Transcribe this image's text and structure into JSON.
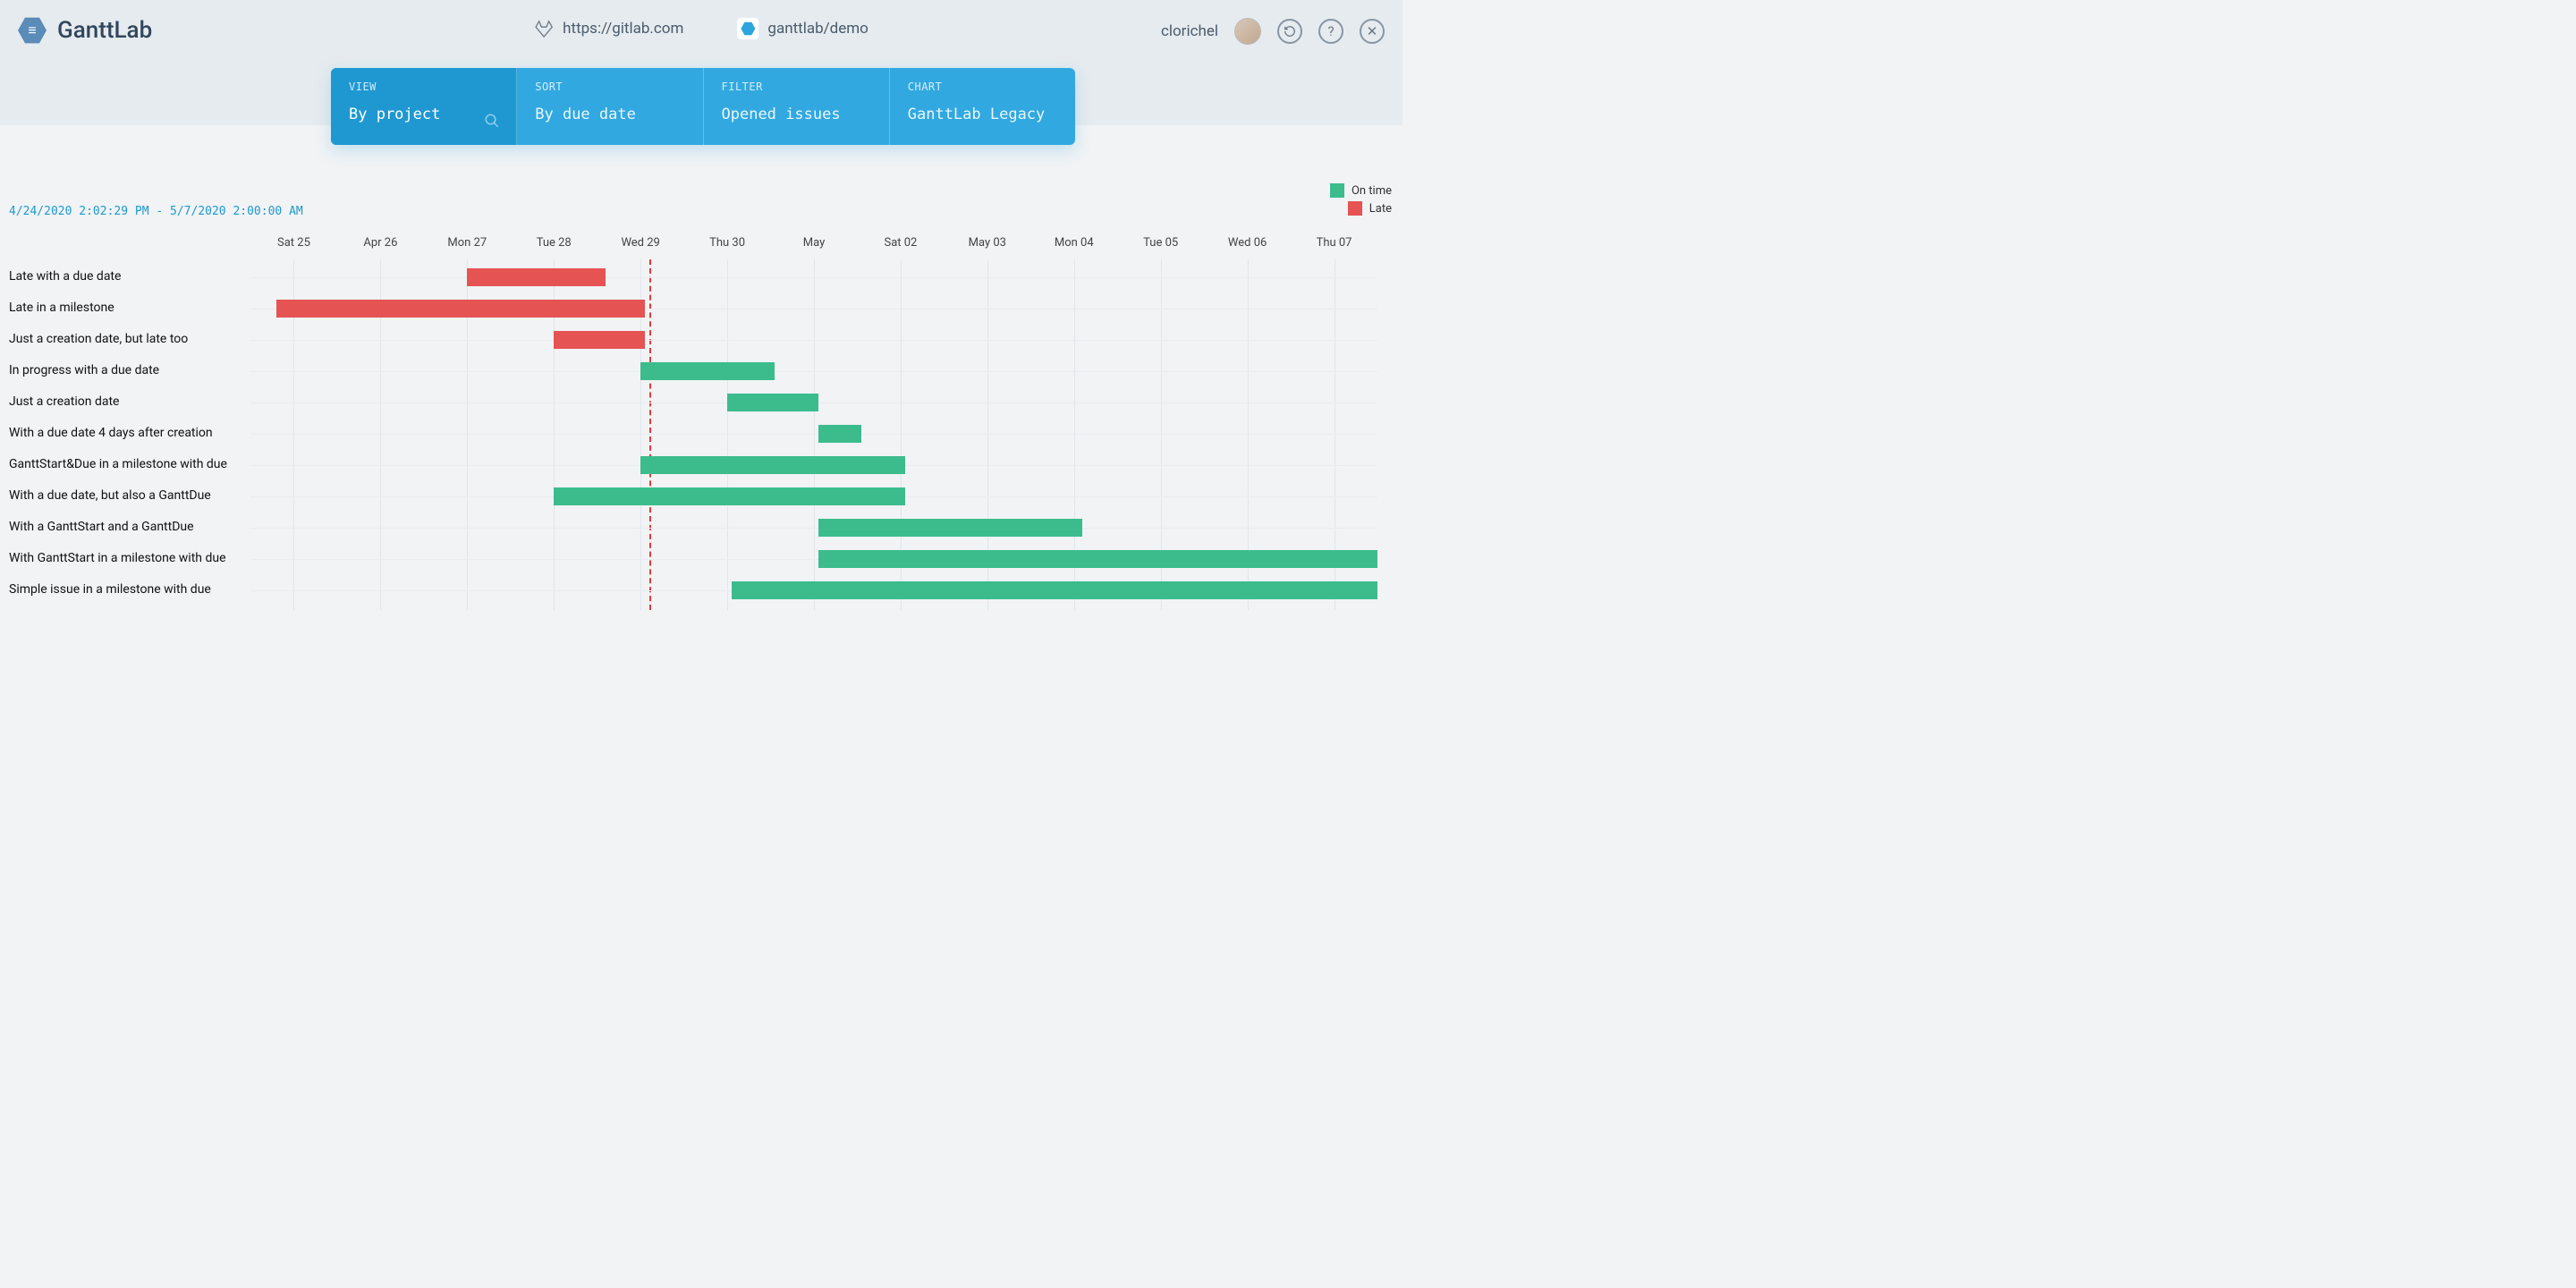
{
  "brand": {
    "title": "GanttLab"
  },
  "header": {
    "source_url": "https://gitlab.com",
    "project_path": "ganttlab/demo",
    "username": "clorichel"
  },
  "controls": {
    "view": {
      "label": "VIEW",
      "value": "By project"
    },
    "sort": {
      "label": "SORT",
      "value": "By due date"
    },
    "filter": {
      "label": "FILTER",
      "value": "Opened issues"
    },
    "chart": {
      "label": "CHART",
      "value": "GanttLab Legacy"
    }
  },
  "range_label": "4/24/2020 2:02:29 PM - 5/7/2020 2:00:00 AM",
  "legend": {
    "ontime": "On time",
    "late": "Late"
  },
  "chart_data": {
    "type": "gantt",
    "x_axis_ticks": [
      "Sat 25",
      "Apr 26",
      "Mon 27",
      "Tue 28",
      "Wed 29",
      "Thu 30",
      "May",
      "Sat 02",
      "May 03",
      "Mon 04",
      "Tue 05",
      "Wed 06",
      "Thu 07"
    ],
    "x_range_days": [
      0,
      13
    ],
    "today_index": 4.6,
    "rows": [
      {
        "label": "Late with a due date",
        "start": 2.5,
        "end": 4.1,
        "status": "late"
      },
      {
        "label": "Late in a milestone",
        "start": 0.3,
        "end": 4.55,
        "status": "late"
      },
      {
        "label": "Just a creation date, but late too",
        "start": 3.5,
        "end": 4.55,
        "status": "late"
      },
      {
        "label": "In progress with a due date",
        "start": 4.5,
        "end": 6.05,
        "status": "ontime"
      },
      {
        "label": "Just a creation date",
        "start": 5.5,
        "end": 6.55,
        "status": "ontime"
      },
      {
        "label": "With a due date 4 days after creation",
        "start": 6.55,
        "end": 7.05,
        "status": "ontime"
      },
      {
        "label": "GanttStart&Due in a milestone with due",
        "start": 4.5,
        "end": 7.55,
        "status": "ontime"
      },
      {
        "label": "With a due date, but also a GanttDue",
        "start": 3.5,
        "end": 7.55,
        "status": "ontime"
      },
      {
        "label": "With a GanttStart and a GanttDue",
        "start": 6.55,
        "end": 9.6,
        "status": "ontime"
      },
      {
        "label": "With GanttStart in a milestone with due",
        "start": 6.55,
        "end": 13.0,
        "status": "ontime"
      },
      {
        "label": "Simple issue in a milestone with due",
        "start": 5.55,
        "end": 13.0,
        "status": "ontime"
      }
    ],
    "colors": {
      "ontime": "#3cbc8d",
      "late": "#e55353"
    }
  }
}
